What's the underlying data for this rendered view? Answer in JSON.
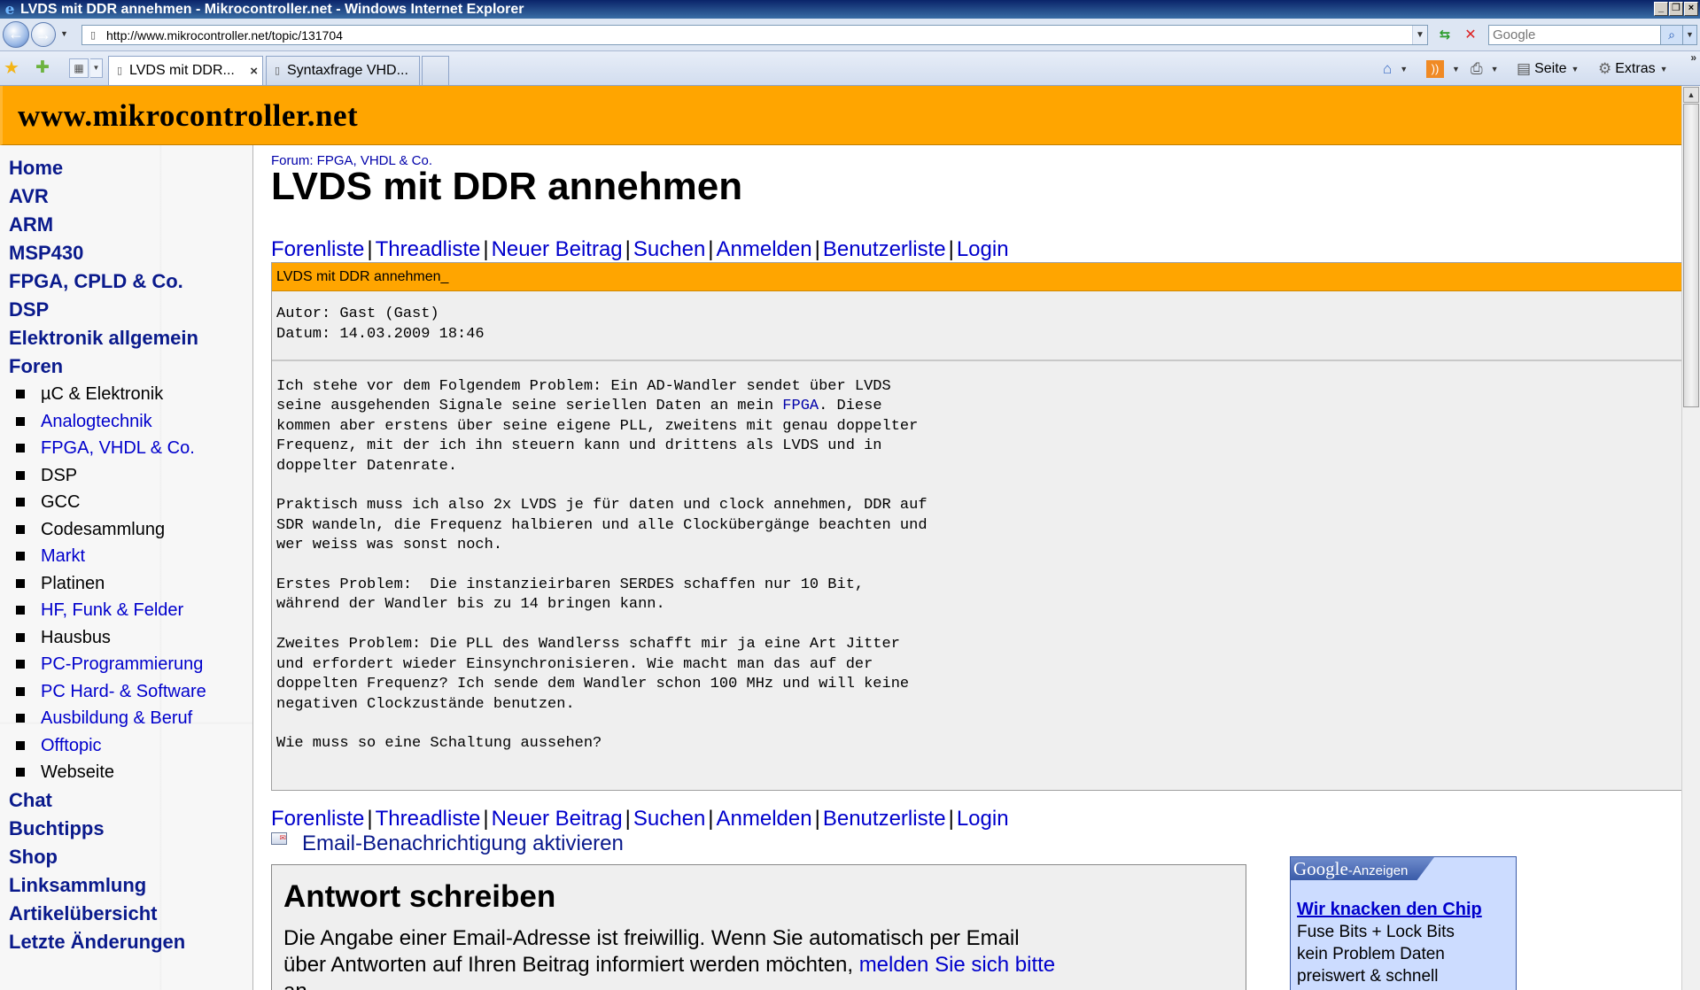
{
  "window": {
    "title": "LVDS mit DDR annehmen - Mikrocontroller.net - Windows Internet Explorer",
    "buttons": [
      "_",
      "❐",
      "×"
    ]
  },
  "address": {
    "url": "http://www.mikrocontroller.net/topic/131704",
    "search_placeholder": "Google"
  },
  "tabs": [
    {
      "label": "LVDS mit DDR...",
      "active": true
    },
    {
      "label": "Syntaxfrage VHD...",
      "active": false
    }
  ],
  "commands": {
    "page_label": "Seite",
    "extras_label": "Extras"
  },
  "site": {
    "title": "www.mikrocontroller.net"
  },
  "sidebar": {
    "main_top": [
      "Home",
      "AVR",
      "ARM",
      "MSP430",
      "FPGA, CPLD & Co.",
      "DSP",
      "Elektronik allgemein",
      "Foren"
    ],
    "forums": [
      {
        "label": "µC & Elektronik",
        "link": false
      },
      {
        "label": "Analogtechnik",
        "link": true
      },
      {
        "label": "FPGA, VHDL & Co.",
        "link": true
      },
      {
        "label": "DSP",
        "link": false
      },
      {
        "label": "GCC",
        "link": false
      },
      {
        "label": "Codesammlung",
        "link": false
      },
      {
        "label": "Markt",
        "link": true
      },
      {
        "label": "Platinen",
        "link": false
      },
      {
        "label": "HF, Funk & Felder",
        "link": true
      },
      {
        "label": "Hausbus",
        "link": false
      },
      {
        "label": "PC-Programmierung",
        "link": true
      },
      {
        "label": "PC Hard- & Software",
        "link": true
      },
      {
        "label": "Ausbildung & Beruf",
        "link": true
      },
      {
        "label": "Offtopic",
        "link": true
      },
      {
        "label": "Webseite",
        "link": false
      }
    ],
    "main_bottom": [
      "Chat",
      "Buchtipps",
      "Shop",
      "Linksammlung",
      "Artikelübersicht",
      "Letzte Änderungen"
    ]
  },
  "thread": {
    "forum_crumb": "Forum: FPGA, VHDL & Co.",
    "title": "LVDS mit DDR annehmen",
    "links": [
      "Forenliste",
      "Threadliste",
      "Neuer Beitrag",
      "Suchen",
      "Anmelden",
      "Benutzerliste",
      "Login"
    ]
  },
  "post": {
    "subject": "LVDS mit DDR annehmen_",
    "author": "Autor: Gast (Gast)",
    "date": "Datum: 14.03.2009 18:46",
    "body_before_link": "Ich stehe vor dem Folgendem Problem: Ein AD-Wandler sendet über LVDS\nseine ausgehenden Signale seine seriellen Daten an mein ",
    "body_link": "FPGA",
    "body_after_link": ". Diese\nkommen aber erstens über seine eigene PLL, zweitens mit genau doppelter\nFrequenz, mit der ich ihn steuern kann und drittens als LVDS und in\ndoppelter Datenrate.\n\nPraktisch muss ich also 2x LVDS je für daten und clock annehmen, DDR auf\nSDR wandeln, die Frequenz halbieren und alle Clockübergänge beachten und\nwer weiss was sonst noch.\n\nErstes Problem:  Die instanzieirbaren SERDES schaffen nur 10 Bit,\nwährend der Wandler bis zu 14 bringen kann.\n\nZweites Problem: Die PLL des Wandlerss schafft mir ja eine Art Jitter\nund erfordert wieder Einsynchronisieren. Wie macht man das auf der\ndoppelten Frequenz? Ich sende dem Wandler schon 100 MHz und will keine\nnegativen Clockzustände benutzen.\n\nWie muss so eine Schaltung aussehen?"
  },
  "notify": {
    "label": "Email-Benachrichtigung aktivieren"
  },
  "reply": {
    "title": "Antwort schreiben",
    "text_line1": "Die Angabe einer Email-Adresse ist freiwillig. Wenn Sie automatisch per Email",
    "text_line2": "über Antworten auf Ihren Beitrag informiert werden möchten, ",
    "text_link": "melden Sie sich bitte",
    "text_line3": "an."
  },
  "ad": {
    "brand_word": "Google",
    "brand_suffix": "-Anzeigen",
    "headline": "Wir knacken den Chip",
    "lines": [
      "Fuse Bits + Lock Bits",
      "kein Problem Daten",
      "preiswert & schnell"
    ]
  },
  "colors": {
    "header_orange": "#ffa500",
    "link_blue": "#0000cc",
    "nav_blue": "#0a1a8c",
    "post_bg": "#efefef",
    "ad_bg": "#ccdcff"
  }
}
